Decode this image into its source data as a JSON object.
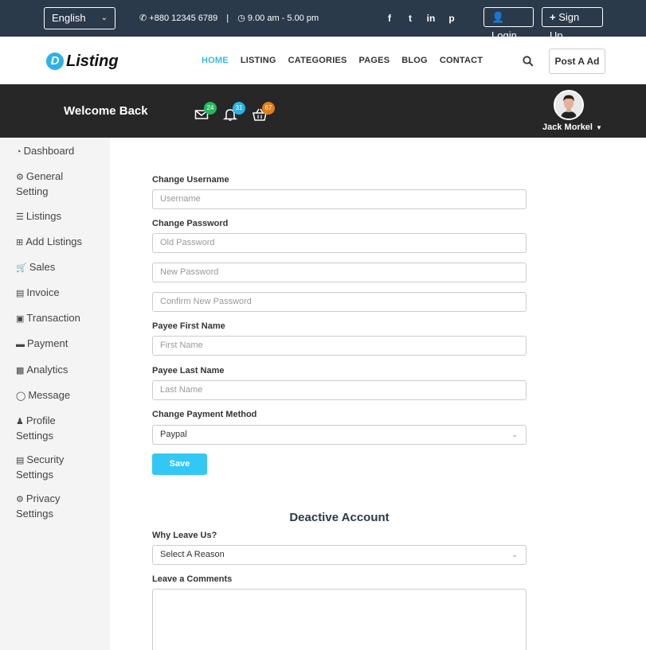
{
  "topbar": {
    "language": "English",
    "phone": "+880 12345 6789",
    "separator": "|",
    "hours": "9.00 am - 5.00 pm",
    "social": [
      "f",
      "t",
      "in",
      "p"
    ],
    "login_label": "Login",
    "signup_label": "Sign Up"
  },
  "navbar": {
    "logo_letter": "D",
    "logo_text": "Listing",
    "links": [
      "HOME",
      "LISTING",
      "CATEGORIES",
      "PAGES",
      "BLOG",
      "CONTACT"
    ],
    "active_link": "HOME",
    "post_label": "Post A Ad"
  },
  "header": {
    "welcome": "Welcome Back",
    "messages_count": "24",
    "notifications_count": "31",
    "cart_count": "67",
    "user_name": "Jack Morkel"
  },
  "sidebar": {
    "items": [
      {
        "label": "Dashboard",
        "icon": "dashboard-icon"
      },
      {
        "label": "General Setting",
        "icon": "gear-icon"
      },
      {
        "label": "Listings",
        "icon": "list-icon"
      },
      {
        "label": "Add Listings",
        "icon": "plus-square-icon"
      },
      {
        "label": "Sales",
        "icon": "cart-icon"
      },
      {
        "label": "Invoice",
        "icon": "file-icon"
      },
      {
        "label": "Transaction",
        "icon": "money-icon"
      },
      {
        "label": "Payment",
        "icon": "credit-card-icon"
      },
      {
        "label": "Analytics",
        "icon": "bar-chart-icon"
      },
      {
        "label": "Message",
        "icon": "comment-icon"
      },
      {
        "label": "Profile Settings",
        "icon": "user-icon"
      },
      {
        "label": "Security Settings",
        "icon": "lock-icon"
      },
      {
        "label": "Privacy Settings",
        "icon": "gear-icon"
      }
    ]
  },
  "form": {
    "username_label": "Change Username",
    "username_placeholder": "Username",
    "password_label": "Change Password",
    "old_password_placeholder": "Old Password",
    "new_password_placeholder": "New Password",
    "confirm_password_placeholder": "Confirm New Password",
    "first_name_label": "Payee First Name",
    "first_name_placeholder": "First Name",
    "last_name_label": "Payee Last Name",
    "last_name_placeholder": "Last Name",
    "payment_label": "Change Payment Method",
    "payment_value": "Paypal",
    "save_label": "Save"
  },
  "deactivate": {
    "title": "Deactive Account",
    "reason_label": "Why Leave Us?",
    "reason_value": "Select A Reason",
    "comments_label": "Leave a Comments"
  },
  "colors": {
    "topbar": "#2b3a4a",
    "accent": "#33c7f5",
    "header": "#272727",
    "sidebar": "#f4f4f4"
  }
}
